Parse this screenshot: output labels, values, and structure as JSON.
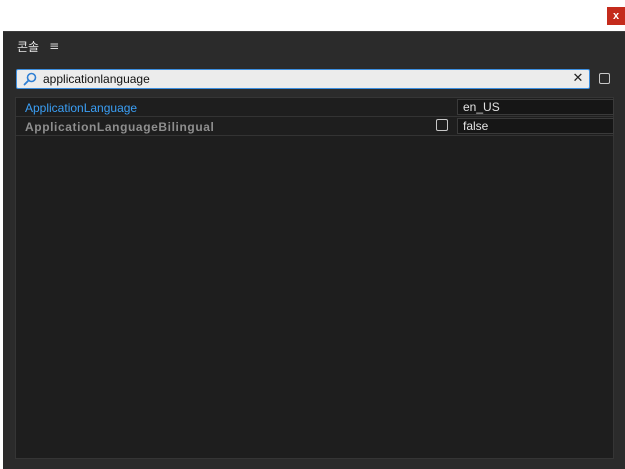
{
  "window": {
    "close_label": "x"
  },
  "panel": {
    "title": "콘솔",
    "menu_icon": "≡"
  },
  "search": {
    "value": "applicationlanguage",
    "icon": "magnifier-icon",
    "clear_label": "✕"
  },
  "results": [
    {
      "name": "ApplicationLanguage",
      "style": "link",
      "value": "en_US",
      "has_checkbox": false
    },
    {
      "name": "ApplicationLanguageBilingual",
      "style": "bold",
      "value": "false",
      "has_checkbox": true
    }
  ],
  "colors": {
    "panel_bg": "#2b2b2b",
    "list_bg": "#1e1e1e",
    "accent_blue": "#3b9ff5",
    "focus_border": "#3d8fe0",
    "close_red": "#c42b1c"
  }
}
